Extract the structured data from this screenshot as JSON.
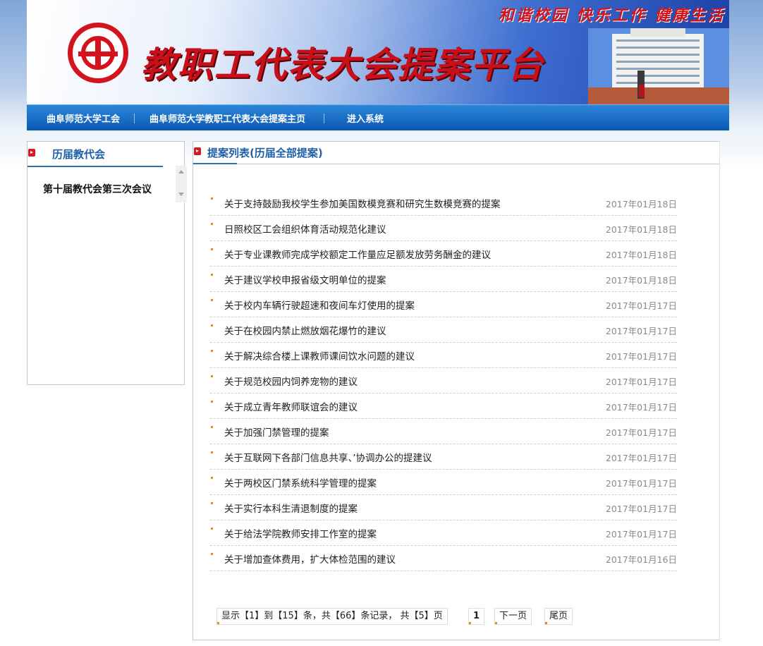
{
  "banner": {
    "title": "教职工代表大会提案平台",
    "slogan": "和谐校园  快乐工作  健康生活"
  },
  "nav": {
    "items": [
      {
        "label": "曲阜师范大学工会"
      },
      {
        "label": "曲阜师范大学教职工代表大会提案主页"
      },
      {
        "label": "进入系统"
      }
    ]
  },
  "sidebar": {
    "title": "历届教代会",
    "items": [
      {
        "label": "第十届教代会第三次会议"
      }
    ]
  },
  "main": {
    "title": "提案列表(历届全部提案)",
    "proposals": [
      {
        "title": "关于支持鼓励我校学生参加美国数模竞赛和研究生数模竞赛的提案",
        "date": "2017年01月18日"
      },
      {
        "title": "日照校区工会组织体育活动规范化建议",
        "date": "2017年01月18日"
      },
      {
        "title": "关于专业课教师完成学校额定工作量应足额发放劳务酬金的建议",
        "date": "2017年01月18日"
      },
      {
        "title": "关于建议学校申报省级文明单位的提案",
        "date": "2017年01月18日"
      },
      {
        "title": "关于校内车辆行驶超速和夜间车灯使用的提案",
        "date": "2017年01月17日"
      },
      {
        "title": "关于在校园内禁止燃放烟花爆竹的建议",
        "date": "2017年01月17日"
      },
      {
        "title": "关于解决综合楼上课教师课间饮水问题的建议",
        "date": "2017年01月17日"
      },
      {
        "title": "关于规范校园内饲养宠物的建议",
        "date": "2017年01月17日"
      },
      {
        "title": "关于成立青年教师联谊会的建议",
        "date": "2017年01月17日"
      },
      {
        "title": "关于加强门禁管理的提案",
        "date": "2017年01月17日"
      },
      {
        "title": "关于互联网下各部门信息共享、’协调办公的提建议",
        "date": "2017年01月17日"
      },
      {
        "title": "关于两校区门禁系统科学管理的提案",
        "date": "2017年01月17日"
      },
      {
        "title": "关于实行本科生清退制度的提案",
        "date": "2017年01月17日"
      },
      {
        "title": "关于给法学院教师安排工作室的提案",
        "date": "2017年01月17日"
      },
      {
        "title": "关于增加查体费用，扩大体检范围的建议",
        "date": "2017年01月16日"
      }
    ]
  },
  "pager": {
    "summary": "显示【1】到【15】条，共【66】条记录， 共【5】页",
    "current_page": "1",
    "next_label": "下一页",
    "last_label": "尾页"
  },
  "colors": {
    "accent_blue": "#1d60a8",
    "nav_blue": "#0c58b3",
    "emblem_red": "#d4141c",
    "bullet_orange": "#e38d19"
  }
}
